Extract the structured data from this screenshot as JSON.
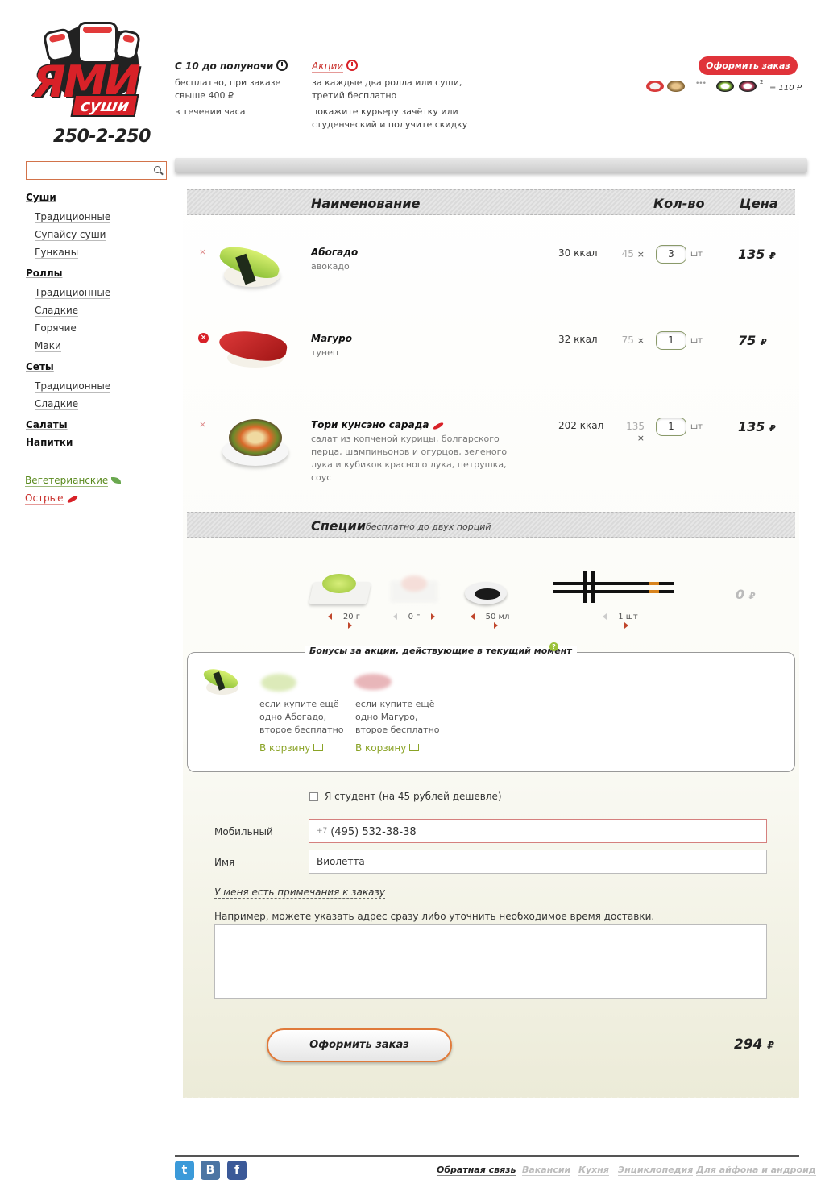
{
  "brand": {
    "logo_main": "ЯМИ",
    "logo_sub": "суши",
    "phone": "250-2-250"
  },
  "header": {
    "delivery_title": "С 10 до полуночи",
    "delivery_text": [
      "бесплатно, при заказе",
      "свыше 400 ₽",
      "в течении часа"
    ],
    "promo_title": "Акции",
    "promo_text": [
      "за каждые два ролла или суши,",
      "третий бесплатно",
      "покажите курьеру зачётку или",
      "студенческий и получите скидку"
    ],
    "order_button": "Оформить заказ",
    "cart_dots": "•••",
    "cart_sup": "2",
    "cart_total": "= 110 ₽"
  },
  "search": {
    "placeholder": ""
  },
  "sidebar": {
    "sushi": "Суши",
    "sushi_items": [
      "Традиционные",
      "Супайсу суши",
      "Гунканы"
    ],
    "rolls": "Роллы",
    "rolls_items": [
      "Традиционные",
      "Сладкие",
      "Горячие",
      "Маки"
    ],
    "sets": "Сеты",
    "sets_items": [
      "Традиционные",
      "Сладкие"
    ],
    "salads": "Салаты",
    "drinks": "Напитки",
    "veg": "Вегетерианские",
    "spicy": "Острые"
  },
  "table": {
    "col_name": "Наименование",
    "col_qty": "Кол-во",
    "col_price": "Цена"
  },
  "products": [
    {
      "name": "Абогадо",
      "desc": "авокадо",
      "kcal": "30 ккал",
      "unit_price": "45",
      "x": "×",
      "qty": "3",
      "sht": "шт",
      "price": "135",
      "cur": "₽",
      "remove": "×"
    },
    {
      "name": "Магуро",
      "desc": "тунец",
      "kcal": "32 ккал",
      "unit_price": "75",
      "x": "×",
      "qty": "1",
      "sht": "шт",
      "price": "75",
      "cur": "₽",
      "remove": "×"
    },
    {
      "name": "Тори кунсэно сарада",
      "desc": "салат из копченой курицы,  болгарского перца, шампиньонов и огурцов, зеленого лука и кубиков красного лука, петрушка, соус",
      "kcal": "202 ккал",
      "unit_price": "135",
      "x": "×",
      "qty": "1",
      "sht": "шт",
      "price": "135",
      "cur": "₽",
      "remove": "×"
    }
  ],
  "spices": {
    "title": "Специи",
    "subtitle": "бесплатно до двух порций",
    "wasabi": "20 г",
    "ginger": "0 г",
    "soy": "50 мл",
    "sticks": "1 шт",
    "price": "0",
    "cur": "₽"
  },
  "bonus": {
    "title": "Бонусы за акции, действующие в текущий момент",
    "help": "?",
    "items": [
      {
        "text": [
          "если купите ещё",
          "одно Абогадо,",
          "второе бесплатно"
        ],
        "link": "В корзину"
      },
      {
        "text": [
          "если купите ещё",
          "одно Магуро,",
          "второе бесплатно"
        ],
        "link": "В корзину"
      }
    ]
  },
  "form": {
    "student": "Я студент (на 45 рублей дешевле)",
    "mobile_label": "Мобильный",
    "mobile_prefix": "+7",
    "mobile_value": "(495) 532-38-38",
    "name_label": "Имя",
    "name_value": "Виолетта",
    "note_link": "У меня есть примечания к заказу",
    "note_hint": "Например, можете указать адрес сразу либо уточнить необходимое время доставки.",
    "submit": "Оформить заказ",
    "total": "294",
    "cur": "₽"
  },
  "footer": {
    "social": [
      "t",
      "B",
      "f"
    ],
    "links": [
      "Обратная связь",
      "Вакансии",
      "Кухня",
      "Энциклопедия",
      "Для айфона и андроид"
    ]
  },
  "colors": {
    "accent": "#d82128",
    "green": "#8aa326",
    "orange": "#e07a3a"
  }
}
